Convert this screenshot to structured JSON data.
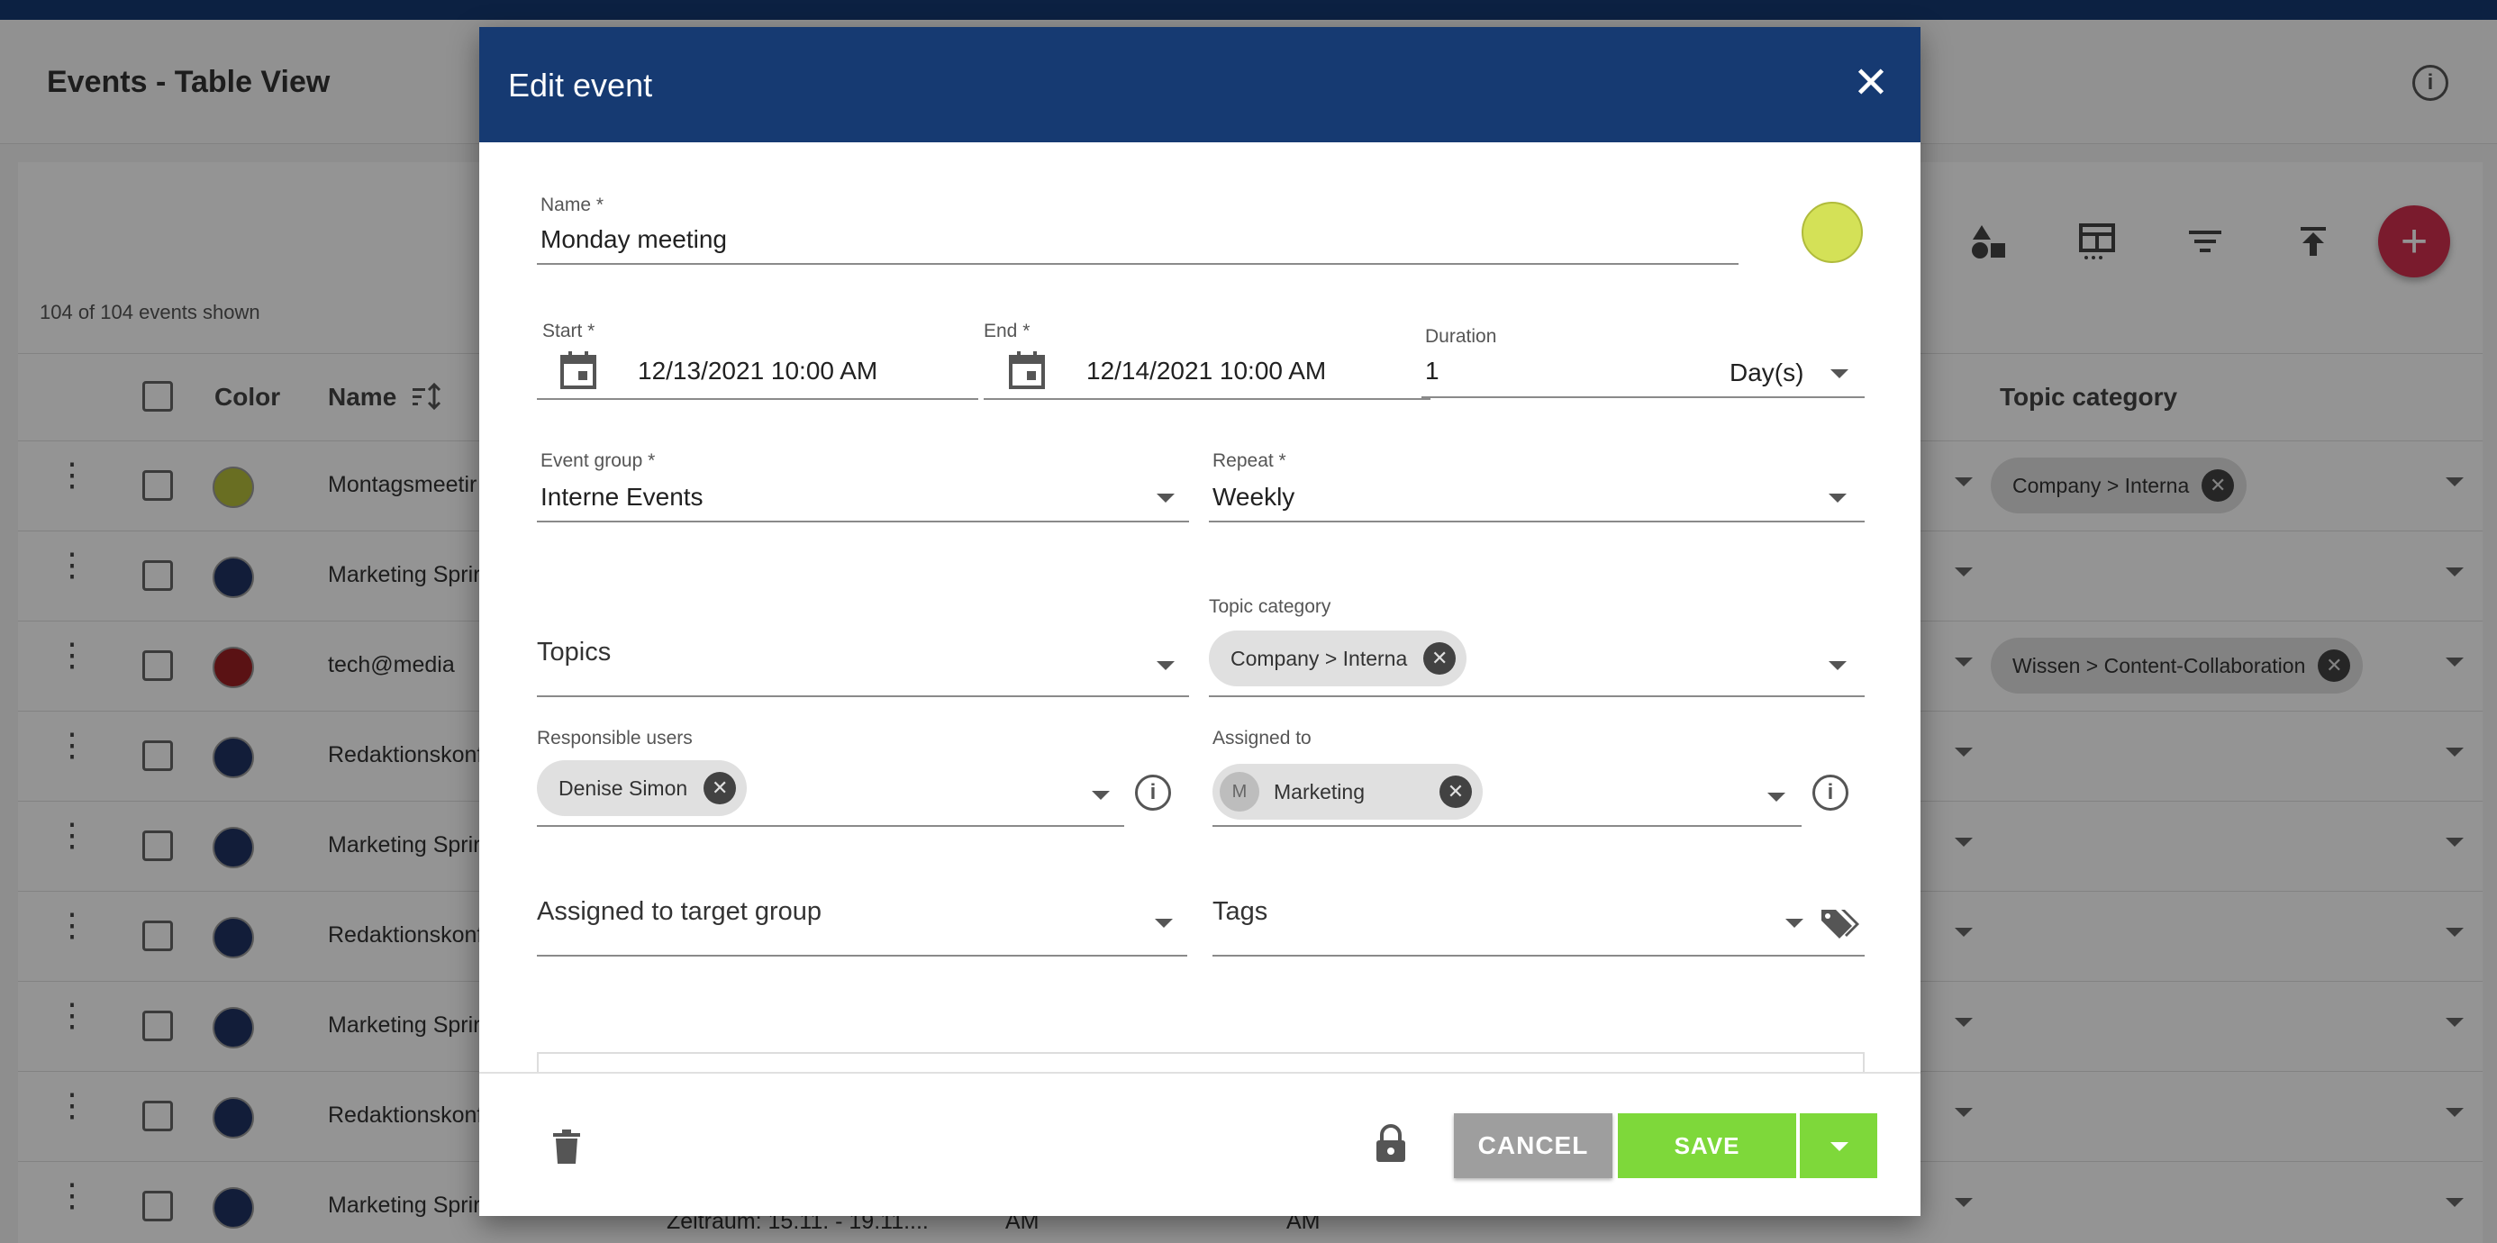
{
  "app": {
    "page_title": "Events - Table View",
    "events_count": "104 of 104 events shown",
    "add_label": "+"
  },
  "table": {
    "columns": {
      "color": "Color",
      "name": "Name",
      "topic_category": "Topic category"
    },
    "rows": [
      {
        "name": "Montagsmeetir",
        "color": "#b5bd3c",
        "topic": "Company > Interna"
      },
      {
        "name": "Marketing Sprir",
        "color": "#1f3262",
        "topic": ""
      },
      {
        "name": "tech@media",
        "color": "#9c1f24",
        "topic": "Wissen > Content-Collaboration"
      },
      {
        "name": "Redaktionskonf",
        "color": "#1f3262",
        "topic": ""
      },
      {
        "name": "Marketing Sprir",
        "color": "#1f3262",
        "topic": ""
      },
      {
        "name": "Redaktionskonf",
        "color": "#1f3262",
        "topic": ""
      },
      {
        "name": "Marketing Sprir",
        "color": "#1f3262",
        "topic": ""
      },
      {
        "name": "Redaktionskonf",
        "color": "#1f3262",
        "topic": ""
      },
      {
        "name": "Marketing Sprir",
        "color": "#1f3262",
        "topic": ""
      }
    ],
    "bottom_fragments": {
      "period": "Zeitraum: 15.11. - 19.11....",
      "am1": "AM",
      "am2": "AM"
    }
  },
  "dialog": {
    "title": "Edit event",
    "close_icon": "close-icon",
    "name": {
      "label": "Name *",
      "value": "Monday meeting",
      "color": "#d4e157"
    },
    "start": {
      "label": "Start *",
      "value": "12/13/2021 10:00 AM"
    },
    "end": {
      "label": "End *",
      "value": "12/14/2021 10:00 AM"
    },
    "duration": {
      "label": "Duration",
      "value": "1",
      "unit": "Day(s)"
    },
    "event_group": {
      "label": "Event group *",
      "value": "Interne Events"
    },
    "repeat": {
      "label": "Repeat *",
      "value": "Weekly"
    },
    "topics": {
      "placeholder": "Topics"
    },
    "topic_category": {
      "label": "Topic category",
      "chip": "Company > Interna"
    },
    "responsible_users": {
      "label": "Responsible users",
      "chip": "Denise Simon"
    },
    "assigned_to": {
      "label": "Assigned to",
      "chip": "Marketing",
      "avatar": "M"
    },
    "target_group": {
      "placeholder": "Assigned to target group"
    },
    "tags": {
      "placeholder": "Tags"
    },
    "footer": {
      "cancel": "CANCEL",
      "save": "SAVE"
    }
  }
}
